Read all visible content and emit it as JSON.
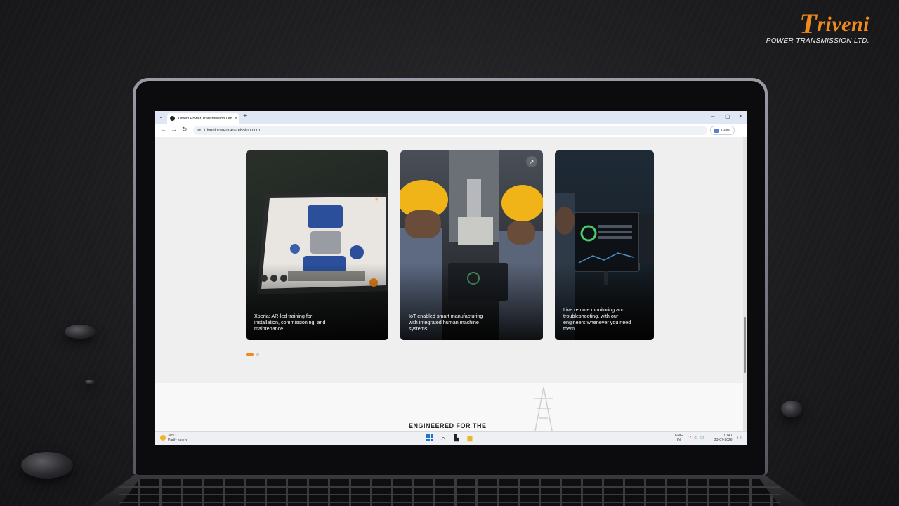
{
  "brand": {
    "mark_t": "T",
    "mark_rest": "riveni",
    "subtitle": "POWER TRANSMISSION LTD."
  },
  "browser": {
    "tab_title": "Triveni Power Transmission Lim",
    "tab_close": "×",
    "new_tab": "+",
    "menu_down": "⌄",
    "win_min": "–",
    "win_max": "▢",
    "win_close": "✕",
    "url": "trivenipowertransmission.com",
    "guest_label": "Guest",
    "back": "←",
    "forward": "→",
    "reload": "↻",
    "kebab": "⋮"
  },
  "cards": [
    {
      "caption": "Xperia: AR-led training for installation, commissioning, and maintenance."
    },
    {
      "caption": "IoT enabled smart manufacturing with integrated human machine systems."
    },
    {
      "caption": "Live remote monitoring and troubleshooting, with our engineers whenever you need them."
    }
  ],
  "card_arrow": "↗",
  "section_title": "ENGINEERED FOR THE",
  "carousel": {
    "active_index": 0,
    "total": 2
  },
  "taskbar": {
    "temperature": "30°C",
    "weather": "Partly sunny",
    "lang_line1": "ENG",
    "lang_line2": "IN",
    "time": "10:41",
    "date": "23-07-2026",
    "tray_chevron": "⌃"
  },
  "colors": {
    "accent": "#f08a1c",
    "page_bg": "#efefef",
    "taskbar_bg": "#eef0f3"
  },
  "icons": [
    "windows-start-icon",
    "search-icon",
    "task-view-icon",
    "file-explorer-icon",
    "wifi-icon",
    "volume-icon",
    "battery-icon",
    "notification-icon"
  ]
}
